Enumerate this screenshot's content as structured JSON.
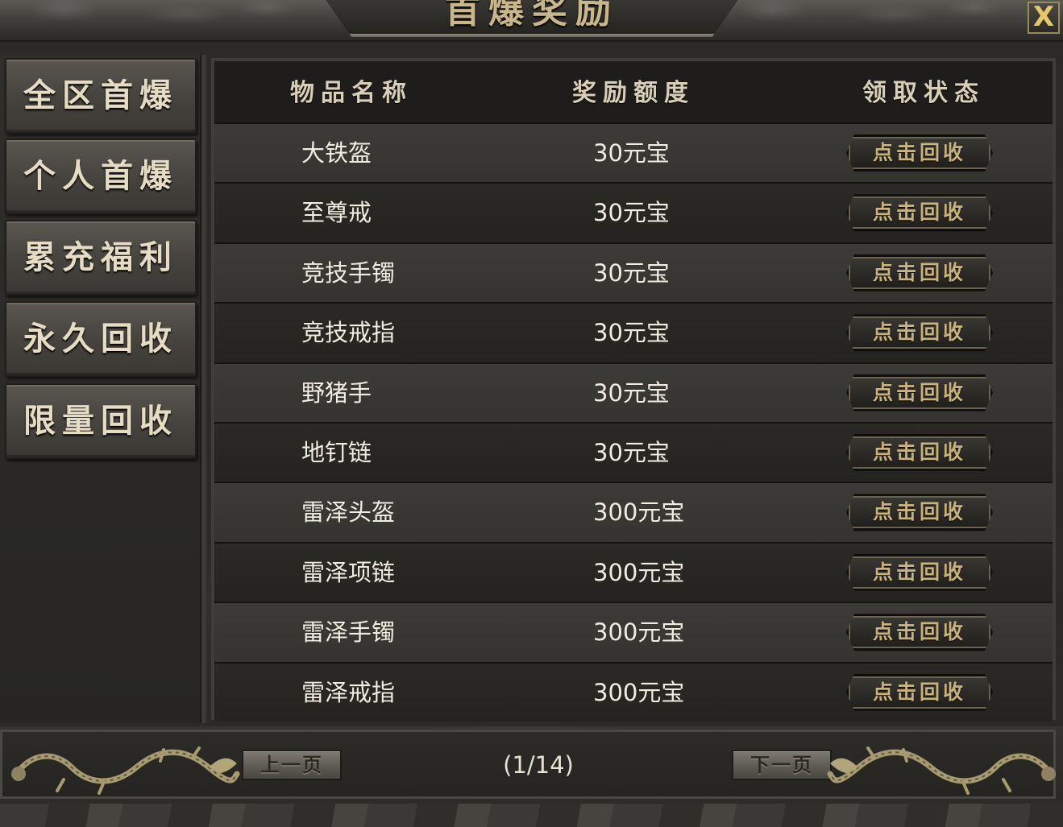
{
  "window": {
    "title": "首爆奖励",
    "close_label": "X"
  },
  "sidebar": {
    "items": [
      {
        "label": "全区首爆"
      },
      {
        "label": "个人首爆"
      },
      {
        "label": "累充福利"
      },
      {
        "label": "永久回收"
      },
      {
        "label": "限量回收"
      }
    ]
  },
  "table": {
    "headers": {
      "name": "物品名称",
      "reward": "奖励额度",
      "status": "领取状态"
    },
    "rows": [
      {
        "name": "大铁盔",
        "reward": "30元宝",
        "action": "点击回收"
      },
      {
        "name": "至尊戒",
        "reward": "30元宝",
        "action": "点击回收"
      },
      {
        "name": "竞技手镯",
        "reward": "30元宝",
        "action": "点击回收"
      },
      {
        "name": "竞技戒指",
        "reward": "30元宝",
        "action": "点击回收"
      },
      {
        "name": "野猪手",
        "reward": "30元宝",
        "action": "点击回收"
      },
      {
        "name": "地钉链",
        "reward": "30元宝",
        "action": "点击回收"
      },
      {
        "name": "雷泽头盔",
        "reward": "300元宝",
        "action": "点击回收"
      },
      {
        "name": "雷泽项链",
        "reward": "300元宝",
        "action": "点击回收"
      },
      {
        "name": "雷泽手镯",
        "reward": "300元宝",
        "action": "点击回收"
      },
      {
        "name": "雷泽戒指",
        "reward": "300元宝",
        "action": "点击回收"
      }
    ]
  },
  "pagination": {
    "prev_label": "上一页",
    "next_label": "下一页",
    "indicator": "(1/14)"
  },
  "colors": {
    "gold_text": "#c9b68a",
    "button_text": "#c9b27c",
    "row_light": "#3c3b38",
    "row_dark": "#2a2926"
  }
}
